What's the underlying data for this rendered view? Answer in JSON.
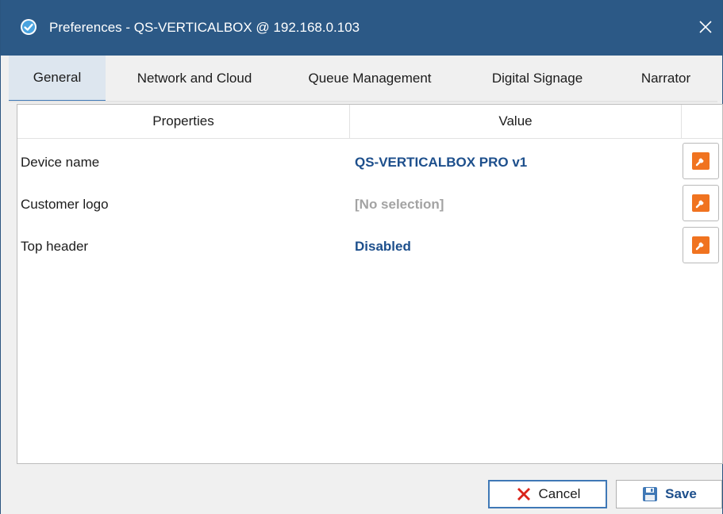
{
  "window": {
    "title": "Preferences - QS-VERTICALBOX @ 192.168.0.103",
    "close_glyph": "✕",
    "app_icon": "check-badge-icon"
  },
  "tabs": [
    {
      "label": "General",
      "active": true
    },
    {
      "label": "Network and Cloud",
      "active": false
    },
    {
      "label": "Queue Management",
      "active": false
    },
    {
      "label": "Digital Signage",
      "active": false
    },
    {
      "label": "Narrator",
      "active": false
    }
  ],
  "grid": {
    "headers": {
      "properties": "Properties",
      "value": "Value"
    },
    "rows": [
      {
        "property": "Device name",
        "value": "QS-VERTICALBOX PRO v1",
        "muted": false,
        "edit_icon": "wrench-icon"
      },
      {
        "property": "Customer logo",
        "value": "[No selection]",
        "muted": true,
        "edit_icon": "wrench-icon"
      },
      {
        "property": "Top header",
        "value": "Disabled",
        "muted": false,
        "edit_icon": "wrench-icon"
      }
    ]
  },
  "buttons": {
    "cancel_label": "Cancel",
    "save_label": "Save",
    "cancel_icon": "red-x-icon",
    "save_icon": "floppy-disk-icon"
  },
  "colors": {
    "titlebar": "#2c5986",
    "accent": "#3f78b6",
    "value_text": "#1d4f8c",
    "muted_text": "#a3a3a3",
    "edit_button_icon": "#f07320",
    "cancel_icon": "#d9231a"
  }
}
